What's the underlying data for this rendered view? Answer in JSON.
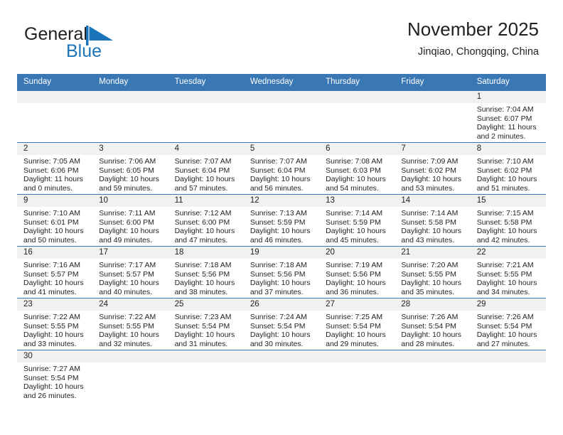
{
  "brand": {
    "name_line1": "General",
    "name_line2": "Blue",
    "accent_color": "#1b75bb",
    "flag_icon": "triangle-flag-icon"
  },
  "header": {
    "title": "November 2025",
    "subtitle": "Jinqiao, Chongqing, China"
  },
  "calendar": {
    "header_bg": "#3a77b5",
    "daynum_bg": "#f1f1f1",
    "weekdays": [
      "Sunday",
      "Monday",
      "Tuesday",
      "Wednesday",
      "Thursday",
      "Friday",
      "Saturday"
    ],
    "leading_blanks": 6,
    "days": [
      {
        "day": "1",
        "sunrise": "Sunrise: 7:04 AM",
        "sunset": "Sunset: 6:07 PM",
        "daylight_line1": "Daylight: 11 hours",
        "daylight_line2": "and 2 minutes."
      },
      {
        "day": "2",
        "sunrise": "Sunrise: 7:05 AM",
        "sunset": "Sunset: 6:06 PM",
        "daylight_line1": "Daylight: 11 hours",
        "daylight_line2": "and 0 minutes."
      },
      {
        "day": "3",
        "sunrise": "Sunrise: 7:06 AM",
        "sunset": "Sunset: 6:05 PM",
        "daylight_line1": "Daylight: 10 hours",
        "daylight_line2": "and 59 minutes."
      },
      {
        "day": "4",
        "sunrise": "Sunrise: 7:07 AM",
        "sunset": "Sunset: 6:04 PM",
        "daylight_line1": "Daylight: 10 hours",
        "daylight_line2": "and 57 minutes."
      },
      {
        "day": "5",
        "sunrise": "Sunrise: 7:07 AM",
        "sunset": "Sunset: 6:04 PM",
        "daylight_line1": "Daylight: 10 hours",
        "daylight_line2": "and 56 minutes."
      },
      {
        "day": "6",
        "sunrise": "Sunrise: 7:08 AM",
        "sunset": "Sunset: 6:03 PM",
        "daylight_line1": "Daylight: 10 hours",
        "daylight_line2": "and 54 minutes."
      },
      {
        "day": "7",
        "sunrise": "Sunrise: 7:09 AM",
        "sunset": "Sunset: 6:02 PM",
        "daylight_line1": "Daylight: 10 hours",
        "daylight_line2": "and 53 minutes."
      },
      {
        "day": "8",
        "sunrise": "Sunrise: 7:10 AM",
        "sunset": "Sunset: 6:02 PM",
        "daylight_line1": "Daylight: 10 hours",
        "daylight_line2": "and 51 minutes."
      },
      {
        "day": "9",
        "sunrise": "Sunrise: 7:10 AM",
        "sunset": "Sunset: 6:01 PM",
        "daylight_line1": "Daylight: 10 hours",
        "daylight_line2": "and 50 minutes."
      },
      {
        "day": "10",
        "sunrise": "Sunrise: 7:11 AM",
        "sunset": "Sunset: 6:00 PM",
        "daylight_line1": "Daylight: 10 hours",
        "daylight_line2": "and 49 minutes."
      },
      {
        "day": "11",
        "sunrise": "Sunrise: 7:12 AM",
        "sunset": "Sunset: 6:00 PM",
        "daylight_line1": "Daylight: 10 hours",
        "daylight_line2": "and 47 minutes."
      },
      {
        "day": "12",
        "sunrise": "Sunrise: 7:13 AM",
        "sunset": "Sunset: 5:59 PM",
        "daylight_line1": "Daylight: 10 hours",
        "daylight_line2": "and 46 minutes."
      },
      {
        "day": "13",
        "sunrise": "Sunrise: 7:14 AM",
        "sunset": "Sunset: 5:59 PM",
        "daylight_line1": "Daylight: 10 hours",
        "daylight_line2": "and 45 minutes."
      },
      {
        "day": "14",
        "sunrise": "Sunrise: 7:14 AM",
        "sunset": "Sunset: 5:58 PM",
        "daylight_line1": "Daylight: 10 hours",
        "daylight_line2": "and 43 minutes."
      },
      {
        "day": "15",
        "sunrise": "Sunrise: 7:15 AM",
        "sunset": "Sunset: 5:58 PM",
        "daylight_line1": "Daylight: 10 hours",
        "daylight_line2": "and 42 minutes."
      },
      {
        "day": "16",
        "sunrise": "Sunrise: 7:16 AM",
        "sunset": "Sunset: 5:57 PM",
        "daylight_line1": "Daylight: 10 hours",
        "daylight_line2": "and 41 minutes."
      },
      {
        "day": "17",
        "sunrise": "Sunrise: 7:17 AM",
        "sunset": "Sunset: 5:57 PM",
        "daylight_line1": "Daylight: 10 hours",
        "daylight_line2": "and 40 minutes."
      },
      {
        "day": "18",
        "sunrise": "Sunrise: 7:18 AM",
        "sunset": "Sunset: 5:56 PM",
        "daylight_line1": "Daylight: 10 hours",
        "daylight_line2": "and 38 minutes."
      },
      {
        "day": "19",
        "sunrise": "Sunrise: 7:18 AM",
        "sunset": "Sunset: 5:56 PM",
        "daylight_line1": "Daylight: 10 hours",
        "daylight_line2": "and 37 minutes."
      },
      {
        "day": "20",
        "sunrise": "Sunrise: 7:19 AM",
        "sunset": "Sunset: 5:56 PM",
        "daylight_line1": "Daylight: 10 hours",
        "daylight_line2": "and 36 minutes."
      },
      {
        "day": "21",
        "sunrise": "Sunrise: 7:20 AM",
        "sunset": "Sunset: 5:55 PM",
        "daylight_line1": "Daylight: 10 hours",
        "daylight_line2": "and 35 minutes."
      },
      {
        "day": "22",
        "sunrise": "Sunrise: 7:21 AM",
        "sunset": "Sunset: 5:55 PM",
        "daylight_line1": "Daylight: 10 hours",
        "daylight_line2": "and 34 minutes."
      },
      {
        "day": "23",
        "sunrise": "Sunrise: 7:22 AM",
        "sunset": "Sunset: 5:55 PM",
        "daylight_line1": "Daylight: 10 hours",
        "daylight_line2": "and 33 minutes."
      },
      {
        "day": "24",
        "sunrise": "Sunrise: 7:22 AM",
        "sunset": "Sunset: 5:55 PM",
        "daylight_line1": "Daylight: 10 hours",
        "daylight_line2": "and 32 minutes."
      },
      {
        "day": "25",
        "sunrise": "Sunrise: 7:23 AM",
        "sunset": "Sunset: 5:54 PM",
        "daylight_line1": "Daylight: 10 hours",
        "daylight_line2": "and 31 minutes."
      },
      {
        "day": "26",
        "sunrise": "Sunrise: 7:24 AM",
        "sunset": "Sunset: 5:54 PM",
        "daylight_line1": "Daylight: 10 hours",
        "daylight_line2": "and 30 minutes."
      },
      {
        "day": "27",
        "sunrise": "Sunrise: 7:25 AM",
        "sunset": "Sunset: 5:54 PM",
        "daylight_line1": "Daylight: 10 hours",
        "daylight_line2": "and 29 minutes."
      },
      {
        "day": "28",
        "sunrise": "Sunrise: 7:26 AM",
        "sunset": "Sunset: 5:54 PM",
        "daylight_line1": "Daylight: 10 hours",
        "daylight_line2": "and 28 minutes."
      },
      {
        "day": "29",
        "sunrise": "Sunrise: 7:26 AM",
        "sunset": "Sunset: 5:54 PM",
        "daylight_line1": "Daylight: 10 hours",
        "daylight_line2": "and 27 minutes."
      },
      {
        "day": "30",
        "sunrise": "Sunrise: 7:27 AM",
        "sunset": "Sunset: 5:54 PM",
        "daylight_line1": "Daylight: 10 hours",
        "daylight_line2": "and 26 minutes."
      }
    ]
  }
}
